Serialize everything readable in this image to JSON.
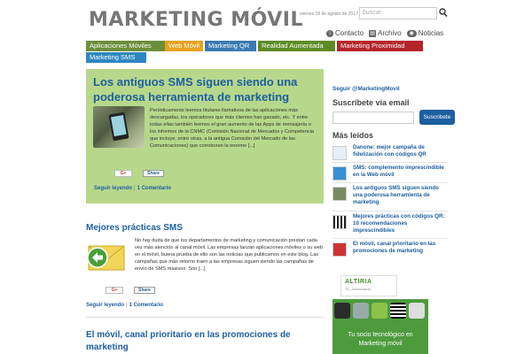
{
  "header": {
    "title": "MARKETING MÓVIL",
    "date": "viernes 18 de agosto de 2017",
    "search_placeholder": "buscar",
    "links": [
      {
        "label": "Contacto",
        "icon": "info-icon"
      },
      {
        "label": "Archivo",
        "icon": "archive-icon"
      },
      {
        "label": "Noticias",
        "icon": "rss-icon"
      }
    ]
  },
  "nav": {
    "items": [
      {
        "label": "Aplicaciones Móviles",
        "color": "#6c8e3a"
      },
      {
        "label": "Web Móvil",
        "color": "#e8a21e"
      },
      {
        "label": "Marketing QR",
        "color": "#3a7ab0"
      },
      {
        "label": "Realidad Aumentada",
        "color": "#5e8c24"
      },
      {
        "label": "Marketing Proximidad",
        "color": "#b6232a"
      },
      {
        "label": "Marketing SMS",
        "color": "#2e86c1"
      }
    ]
  },
  "featured": {
    "title": "Los antiguos SMS siguen siendo una poderosa herramienta de marketing",
    "excerpt": "Periódicamente leemos titulares llamativos de las aplicaciones más descargadas, los operadores que más clientes han ganado, etc. Y entre todas ellas también leemos el gran aumento de las Apps de mensajería o los informes de la CNMC (Comisión Nacional de Mercados y Competencia que incluye, entre otras, a la antigua Comisión del Mercado de las Comunicaciones) que corroboran la enorme [...]",
    "gplus": "G+",
    "linkedin": "Share",
    "read_more": "Seguir leyendo",
    "comments": "1 Comentario"
  },
  "post2": {
    "title": "Mejores prácticas SMS",
    "excerpt": "No hay duda de que los departamentos de marketing y comunicación prestan cada vez más atención al canal móvil. Las empresas lanzan aplicaciones móviles o su web en el móvil, buena prueba de ello son las noticias que publicamos en este blog. Las campañas que más retorno traen a las empresas siguen siendo las campañas de envío de SMS masivos. Son [...]",
    "gplus": "G+",
    "linkedin": "Share",
    "read_more": "Seguir leyendo",
    "comments": "1 Comentario"
  },
  "post3": {
    "title": "El móvil, canal prioritario en las promociones de marketing"
  },
  "sidebar": {
    "follow": "Seguir @MarketingMovil",
    "subscribe_heading": "Suscríbete vía email",
    "subscribe_button": "Suscribete",
    "popular_heading": "Más leídos",
    "popular": [
      "Danone: mejor campaña de fidelización con códigos QR",
      "SMS: complemento imprescindible en la Web móvil",
      "Los antiguos SMS siguen siendo una poderosa herramienta de marketing",
      "Mejores prácticas con códigos QR: 10 recomendaciones imprescindibles",
      "El móvil, canal prioritario en las promociones de marketing"
    ],
    "altiria_logo": "ALTIRIA",
    "altiria_sub": "TIC, comunicación",
    "banner_text": "Tu socio tecnológico en Marketing móvil"
  }
}
